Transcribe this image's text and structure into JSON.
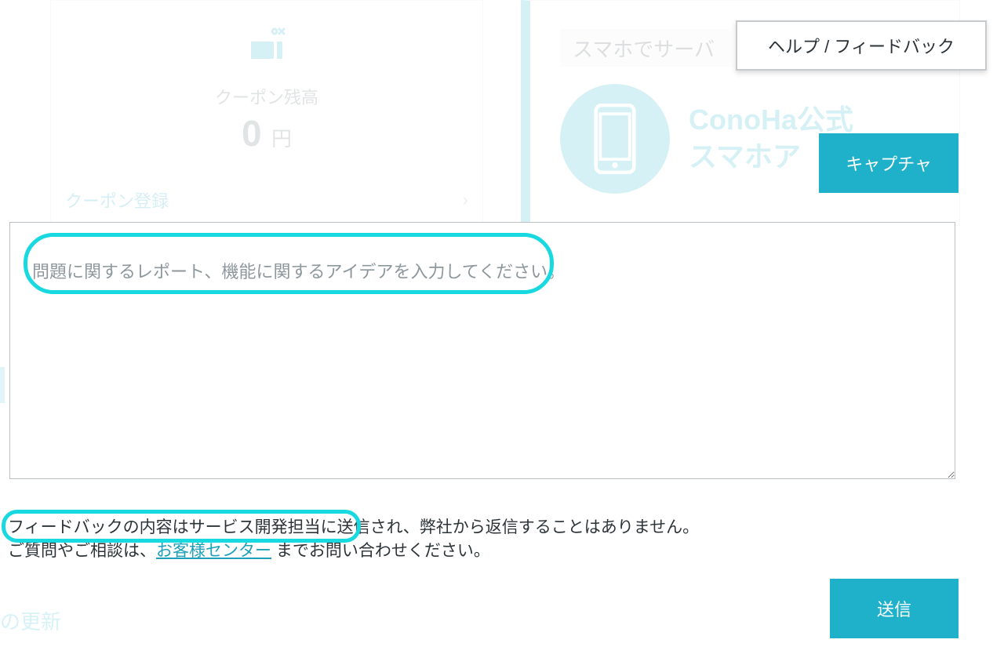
{
  "colors": {
    "accent": "#1fb1c9",
    "highlight": "#19d9e0"
  },
  "background": {
    "coupon": {
      "label": "クーポン残高",
      "amount": "0",
      "unit": "円",
      "register_label": "クーポン登録"
    },
    "right_panel": {
      "top_bar_text": "スマホでサーバ",
      "promo_line1": "ConoHa公式",
      "promo_line2": "スマホア"
    },
    "bottom_text": "の更新"
  },
  "header": {
    "help_feedback_label": "ヘルプ / フィードバック"
  },
  "feedback": {
    "capture_button": "キャプチャ",
    "textarea_placeholder": "問題に関するレポート、機能に関するアイデアを入力してください。",
    "disclaimer_line1": "フィードバックの内容はサービス開発担当に送信され、弊社から返信することはありません。",
    "disclaimer_line2_prefix": "ご質問やご相談は、",
    "disclaimer_link": "お客様センター",
    "disclaimer_line2_suffix": " までお問い合わせください。",
    "submit_button": "送信"
  }
}
